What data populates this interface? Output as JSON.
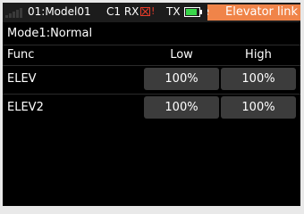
{
  "status_bar": {
    "signal_icon": "signal-bars-icon",
    "model": "01:Model01",
    "receiver": "C1 RX",
    "rx_status_icon": "rx-disconnected-icon",
    "rx_warning": "!",
    "transmitter": "TX",
    "tx_battery_icon": "battery-icon",
    "alert_prefix": "e",
    "alert_text": "Elevator link",
    "colors": {
      "alert": "#f08449",
      "error": "#e83c2a",
      "battery": "#39d64a"
    }
  },
  "page": {
    "title": "Mode1:Normal"
  },
  "table": {
    "func_header": "Func",
    "low_header": "Low",
    "high_header": "High",
    "rows": [
      {
        "func": "ELEV",
        "low": "100%",
        "high": "100%"
      },
      {
        "func": "ELEV2",
        "low": "100%",
        "high": "100%"
      }
    ]
  }
}
